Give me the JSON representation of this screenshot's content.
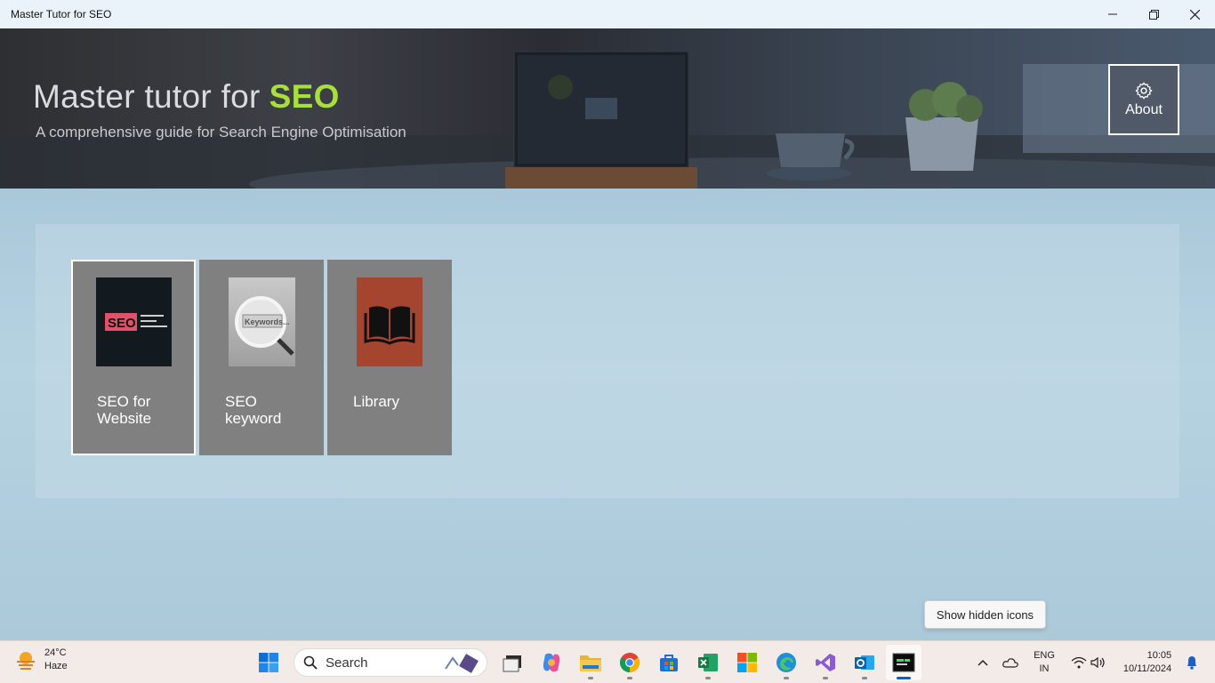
{
  "window": {
    "title": "Master Tutor for SEO"
  },
  "header": {
    "title_main": "Master tutor for",
    "title_accent": "SEO",
    "subtitle": "A comprehensive guide for Search Engine Optimisation",
    "about_label": "About",
    "accent_color": "#a8e03b"
  },
  "tiles": [
    {
      "label_line1": "SEO for",
      "label_line2": "Website",
      "selected": true,
      "image_text": "SEO"
    },
    {
      "label_line1": "SEO",
      "label_line2": "keyword",
      "selected": false,
      "image_text": "Keywords..."
    },
    {
      "label_line1": "Library",
      "label_line2": "",
      "selected": false
    }
  ],
  "tooltip": "Show hidden icons",
  "taskbar": {
    "weather_temp": "24°C",
    "weather_desc": "Haze",
    "search_label": "Search",
    "apps": [
      "start-icon",
      "file-manager-icon",
      "copilot-icon",
      "file-explorer-icon",
      "chrome-icon",
      "store-icon",
      "excel-icon",
      "microsoft-icon",
      "edge-icon",
      "visual-studio-icon",
      "outlook-icon",
      "terminal-icon"
    ],
    "lang_line1": "ENG",
    "lang_line2": "IN",
    "time": "10:05",
    "date": "10/11/2024"
  }
}
